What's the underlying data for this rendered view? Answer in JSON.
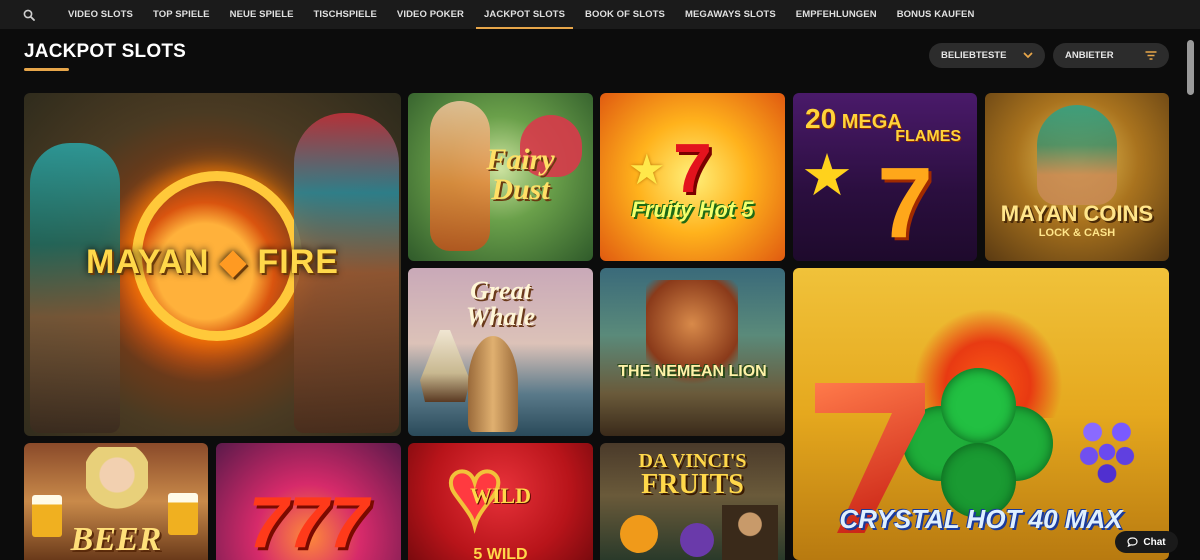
{
  "nav": {
    "items": [
      {
        "label": "VIDEO SLOTS",
        "active": false
      },
      {
        "label": "TOP SPIELE",
        "active": false
      },
      {
        "label": "NEUE SPIELE",
        "active": false
      },
      {
        "label": "TISCHSPIELE",
        "active": false
      },
      {
        "label": "VIDEO POKER",
        "active": false
      },
      {
        "label": "JACKPOT SLOTS",
        "active": true
      },
      {
        "label": "BOOK OF SLOTS",
        "active": false
      },
      {
        "label": "MEGAWAYS SLOTS",
        "active": false
      },
      {
        "label": "EMPFEHLUNGEN",
        "active": false
      },
      {
        "label": "BONUS KAUFEN",
        "active": false
      }
    ],
    "accent": "#e7a64a"
  },
  "page": {
    "title": "JACKPOT SLOTS"
  },
  "filters": {
    "sort_label": "BELIEBTESTE",
    "provider_label": "ANBIETER"
  },
  "games": {
    "mayan_fire": {
      "title": "MAYAN",
      "title2": "FIRE"
    },
    "fairy_dust": {
      "title": "Fairy",
      "title2": "Dust"
    },
    "fruity_hot": {
      "title": "Fruity Hot 5",
      "seven": "7"
    },
    "mega_flames": {
      "title": "MEGA",
      "title2": "FLAMES",
      "prefix": "20",
      "seven": "7"
    },
    "mayan_coins": {
      "title": "MAYAN COINS",
      "subtitle": "LOCK & CASH"
    },
    "great_whale": {
      "title": "Great",
      "title2": "Whale"
    },
    "nemean_lion": {
      "title": "THE NEMEAN LION"
    },
    "crystal_hot": {
      "title": "CRYSTAL HOT 40 MAX"
    },
    "beer": {
      "title": "BEER"
    },
    "triple_seven": {
      "title": "777"
    },
    "wild": {
      "title": "WILD",
      "subtitle": "5 WILD"
    },
    "da_vinci": {
      "title": "DA VINCI'S",
      "title2": "FRUITS"
    }
  },
  "chat": {
    "label": "Chat"
  }
}
